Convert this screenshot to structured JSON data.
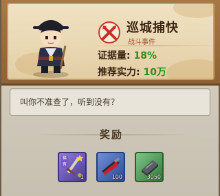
{
  "mission": {
    "title": "巡城捕快",
    "subtitle": "战斗事件",
    "stats": [
      {
        "label": "证据量:",
        "value": "18%"
      },
      {
        "label": "推荐实力:",
        "value": "10万"
      }
    ]
  },
  "dialog": {
    "text": "叫你不准查了，听到没有？"
  },
  "rewards": {
    "header": "奖励",
    "items": [
      {
        "name": "weapon-item",
        "count": "1",
        "badge": "稀有",
        "color": "#5a4aa8"
      },
      {
        "name": "red-scroll-item",
        "count": "100",
        "color": "#3f5fa8"
      },
      {
        "name": "iron-ingot-item",
        "count": "3050",
        "color": "#3d8a46"
      }
    ]
  },
  "colors": {
    "stat_value": "#2c8f1c",
    "subtitle": "#b04a33",
    "title": "#3c2413"
  }
}
